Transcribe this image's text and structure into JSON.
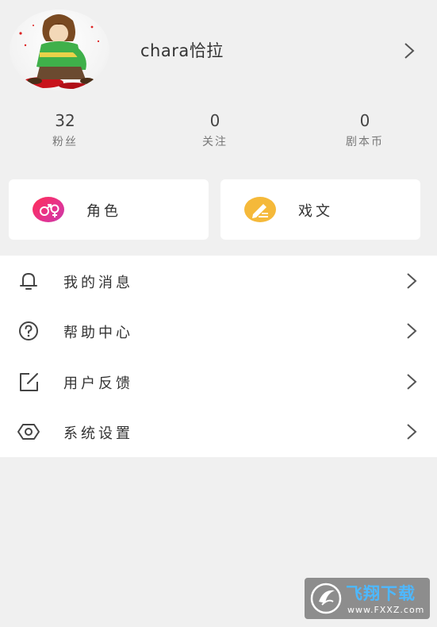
{
  "profile": {
    "username": "chara恰拉",
    "avatar_icon": "avatar-illustration"
  },
  "stats": [
    {
      "value": "32",
      "label": "粉丝"
    },
    {
      "value": "0",
      "label": "关注"
    },
    {
      "value": "0",
      "label": "剧本币"
    }
  ],
  "cards": [
    {
      "label": "角色",
      "icon": "gender-icon",
      "color": "#f0307a"
    },
    {
      "label": "戏文",
      "icon": "pencil-icon",
      "color": "#f5b93a"
    }
  ],
  "menu": [
    {
      "label": "我的消息",
      "icon": "bell-icon"
    },
    {
      "label": "帮助中心",
      "icon": "help-circle-icon"
    },
    {
      "label": "用户反馈",
      "icon": "edit-square-icon"
    },
    {
      "label": "系统设置",
      "icon": "hexagon-settings-icon"
    }
  ],
  "watermark": {
    "title": "飞翔下载",
    "url": "www.FXXZ.com"
  },
  "colors": {
    "background": "#f0f0f0",
    "card": "#ffffff",
    "watermark_accent": "#4db8ff"
  }
}
